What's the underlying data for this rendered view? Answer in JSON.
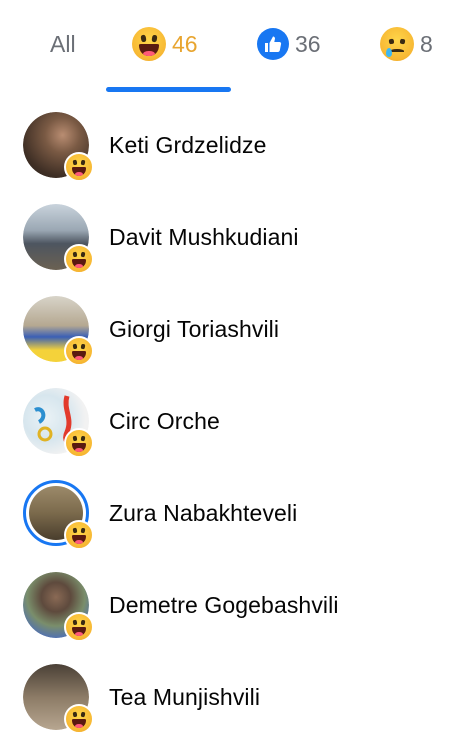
{
  "tabs": [
    {
      "label": "All",
      "type": "all",
      "active": false
    },
    {
      "label": "46",
      "type": "haha",
      "icon": "haha-emoji-icon",
      "active": true
    },
    {
      "label": "36",
      "type": "like",
      "icon": "like-icon",
      "active": false
    },
    {
      "label": "8",
      "type": "sad",
      "icon": "sad-emoji-icon",
      "active": false
    }
  ],
  "colors": {
    "accent": "#1877f2",
    "active_tab_text": "#e8a530",
    "inactive_tab_text": "#6b6f76"
  },
  "people": [
    {
      "name": "Keti Grdzelidze",
      "reaction": "haha"
    },
    {
      "name": "Davit Mushkudiani",
      "reaction": "haha"
    },
    {
      "name": "Giorgi Toriashvili",
      "reaction": "haha"
    },
    {
      "name": "Circ Orche",
      "reaction": "haha"
    },
    {
      "name": "Zura Nabakhteveli",
      "reaction": "haha",
      "story_ring": true
    },
    {
      "name": "Demetre Gogebashvili",
      "reaction": "haha"
    },
    {
      "name": "Tea Munjishvili",
      "reaction": "haha"
    }
  ]
}
